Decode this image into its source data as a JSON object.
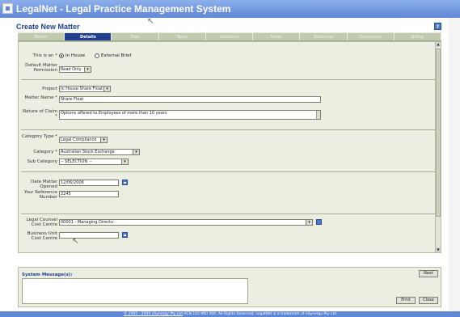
{
  "app": {
    "title": "LegalNet - Legal Practice Management System",
    "subtitle": "Create New Matter",
    "help_icon": "?"
  },
  "tabs": [
    {
      "label": "Matter",
      "active": false
    },
    {
      "label": "Details",
      "active": true
    },
    {
      "label": "Files",
      "active": false
    },
    {
      "label": "Tasks",
      "active": false
    },
    {
      "label": "Additions",
      "active": false
    },
    {
      "label": "Notes",
      "active": false
    },
    {
      "label": "Relations",
      "active": false
    },
    {
      "label": "Documents",
      "active": false
    },
    {
      "label": "Billing",
      "active": false
    }
  ],
  "form": {
    "this_is_an_label": "This is an *",
    "radio_inhouse_label": "In House",
    "radio_external_label": "External Brief",
    "radio_selected": "In House",
    "default_permission_label": "Default Matter Permission",
    "default_permission_value": "Read Only",
    "project_label": "Project",
    "project_value": "In House Share Float",
    "matter_name_label": "Matter Name *",
    "matter_name_value": "Share Float",
    "nature_label": "Nature of Claim *",
    "nature_value": "Options offered to Employees of more than 10 years",
    "category_type_label": "Category Type *",
    "category_type_value": "Legal Compliance",
    "category_label": "Category *",
    "category_value": "Australian Stock Exchange",
    "sub_category_label": "Sub Category",
    "sub_category_value": "-- SELECTION --",
    "date_opened_label": "Date Matter Opened",
    "date_opened_value": "12/06/2006",
    "your_ref_label": "Your Reference Number",
    "your_ref_value": "2245",
    "legal_counsel_label": "Legal Counsel Cost Centre",
    "legal_counsel_value": "00001 - Managing Directo",
    "business_unit_label": "Business Unit Cost Centre",
    "business_unit_value": ""
  },
  "messages": {
    "label": "System Message(s):",
    "text": ""
  },
  "buttons": {
    "next": "Next",
    "print": "Print",
    "close": "Close"
  },
  "footer": {
    "copyright_link": "© 2002 - 2004 nSynergy Pty Ltd",
    "rest": " ACN 102 960 560. All Rights Reserved. LegalNet is a trademark of nSynergy Pty Ltd"
  },
  "colors": {
    "titlebar": "#5f87d6",
    "active_tab": "#1f3f8f",
    "form_bg": "#eceee2"
  },
  "icons": [
    "cursor-pointer-icon",
    "help-icon",
    "calendar-icon",
    "lookup-icon",
    "app-logo-icon"
  ]
}
